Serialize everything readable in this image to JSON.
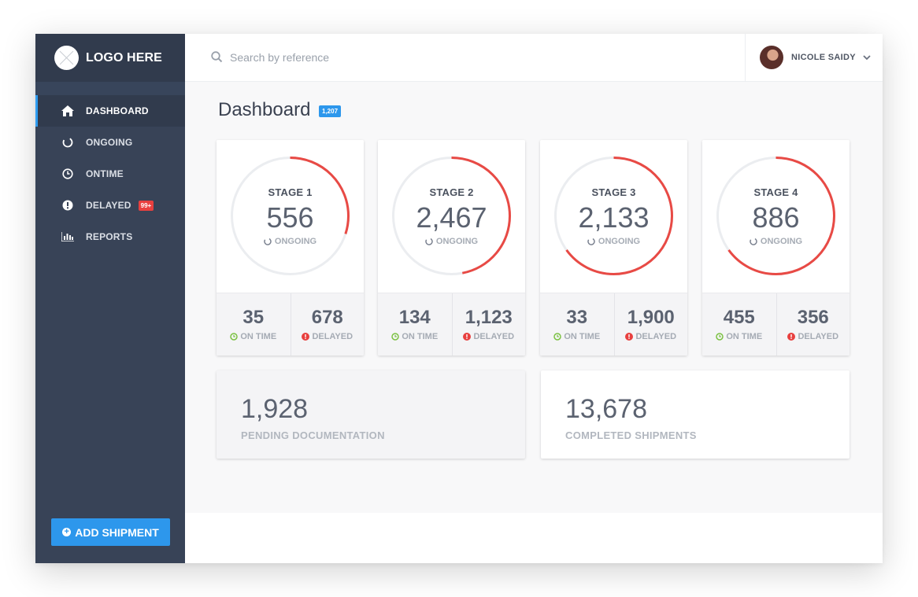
{
  "app": {
    "logo_text": "LOGO HERE"
  },
  "sidebar": {
    "items": [
      {
        "label": "DASHBOARD",
        "icon": "home-icon"
      },
      {
        "label": "ONGOING",
        "icon": "ongoing-icon"
      },
      {
        "label": "ONTIME",
        "icon": "clock-icon"
      },
      {
        "label": "DELAYED",
        "icon": "alert-icon",
        "badge": "99+"
      },
      {
        "label": "REPORTS",
        "icon": "bar-chart-icon"
      }
    ],
    "add_button": "ADD SHIPMENT"
  },
  "search": {
    "placeholder": "Search by reference",
    "value": ""
  },
  "user": {
    "name": "NICOLE SAIDY"
  },
  "page": {
    "title": "Dashboard",
    "badge": "1,207"
  },
  "stages": [
    {
      "label": "STAGE 1",
      "value": "556",
      "status": "ONGOING",
      "progress": 0.3,
      "on_time": "35",
      "on_time_label": "ON TIME",
      "delayed": "678",
      "delayed_label": "DELAYED"
    },
    {
      "label": "STAGE 2",
      "value": "2,467",
      "status": "ONGOING",
      "progress": 0.47,
      "on_time": "134",
      "on_time_label": "ON TIME",
      "delayed": "1,123",
      "delayed_label": "DELAYED"
    },
    {
      "label": "STAGE 3",
      "value": "2,133",
      "status": "ONGOING",
      "progress": 0.65,
      "on_time": "33",
      "on_time_label": "ON TIME",
      "delayed": "1,900",
      "delayed_label": "DELAYED"
    },
    {
      "label": "STAGE 4",
      "value": "886",
      "status": "ONGOING",
      "progress": 0.65,
      "on_time": "455",
      "on_time_label": "ON TIME",
      "delayed": "356",
      "delayed_label": "DELAYED"
    }
  ],
  "summary": [
    {
      "value": "1,928",
      "label": "PENDING DOCUMENTATION"
    },
    {
      "value": "13,678",
      "label": "COMPLETED SHIPMENTS"
    }
  ],
  "colors": {
    "sidebar_bg": "#384357",
    "accent_blue": "#2d97ec",
    "progress_red": "#e84a45",
    "ontime_green": "#7bc142",
    "delayed_red": "#e8403f"
  }
}
